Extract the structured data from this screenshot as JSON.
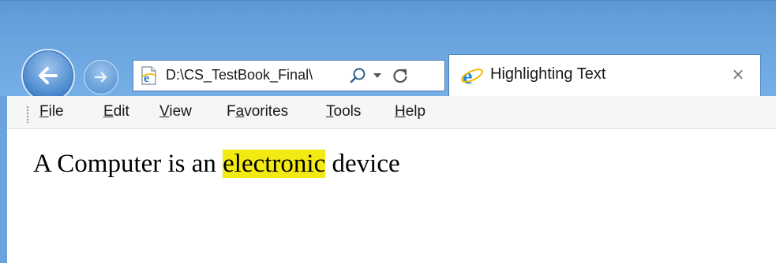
{
  "browser": {
    "address_text": "D:\\CS_TestBook_Final\\",
    "tab_title": "Highlighting Text",
    "tab_close": "×"
  },
  "menu": {
    "file": {
      "accel": "F",
      "rest": "ile"
    },
    "edit": {
      "accel": "E",
      "rest": "dit"
    },
    "view": {
      "accel": "V",
      "rest": "iew"
    },
    "favorites": {
      "pre": "F",
      "accel": "a",
      "rest": "vorites"
    },
    "tools": {
      "accel": "T",
      "rest": "ools"
    },
    "help": {
      "accel": "H",
      "rest": "elp"
    }
  },
  "content": {
    "before": "A Computer is an ",
    "highlighted": "electronic",
    "after": " device",
    "highlight_color": "#f2ea12"
  },
  "colors": {
    "chrome_blue": "#6aa4df",
    "ie_logo_blue": "#1e88e5"
  },
  "icons": [
    "back-icon",
    "forward-icon",
    "page-icon",
    "search-icon",
    "dropdown-icon",
    "refresh-icon",
    "ie-logo-icon",
    "close-icon"
  ]
}
